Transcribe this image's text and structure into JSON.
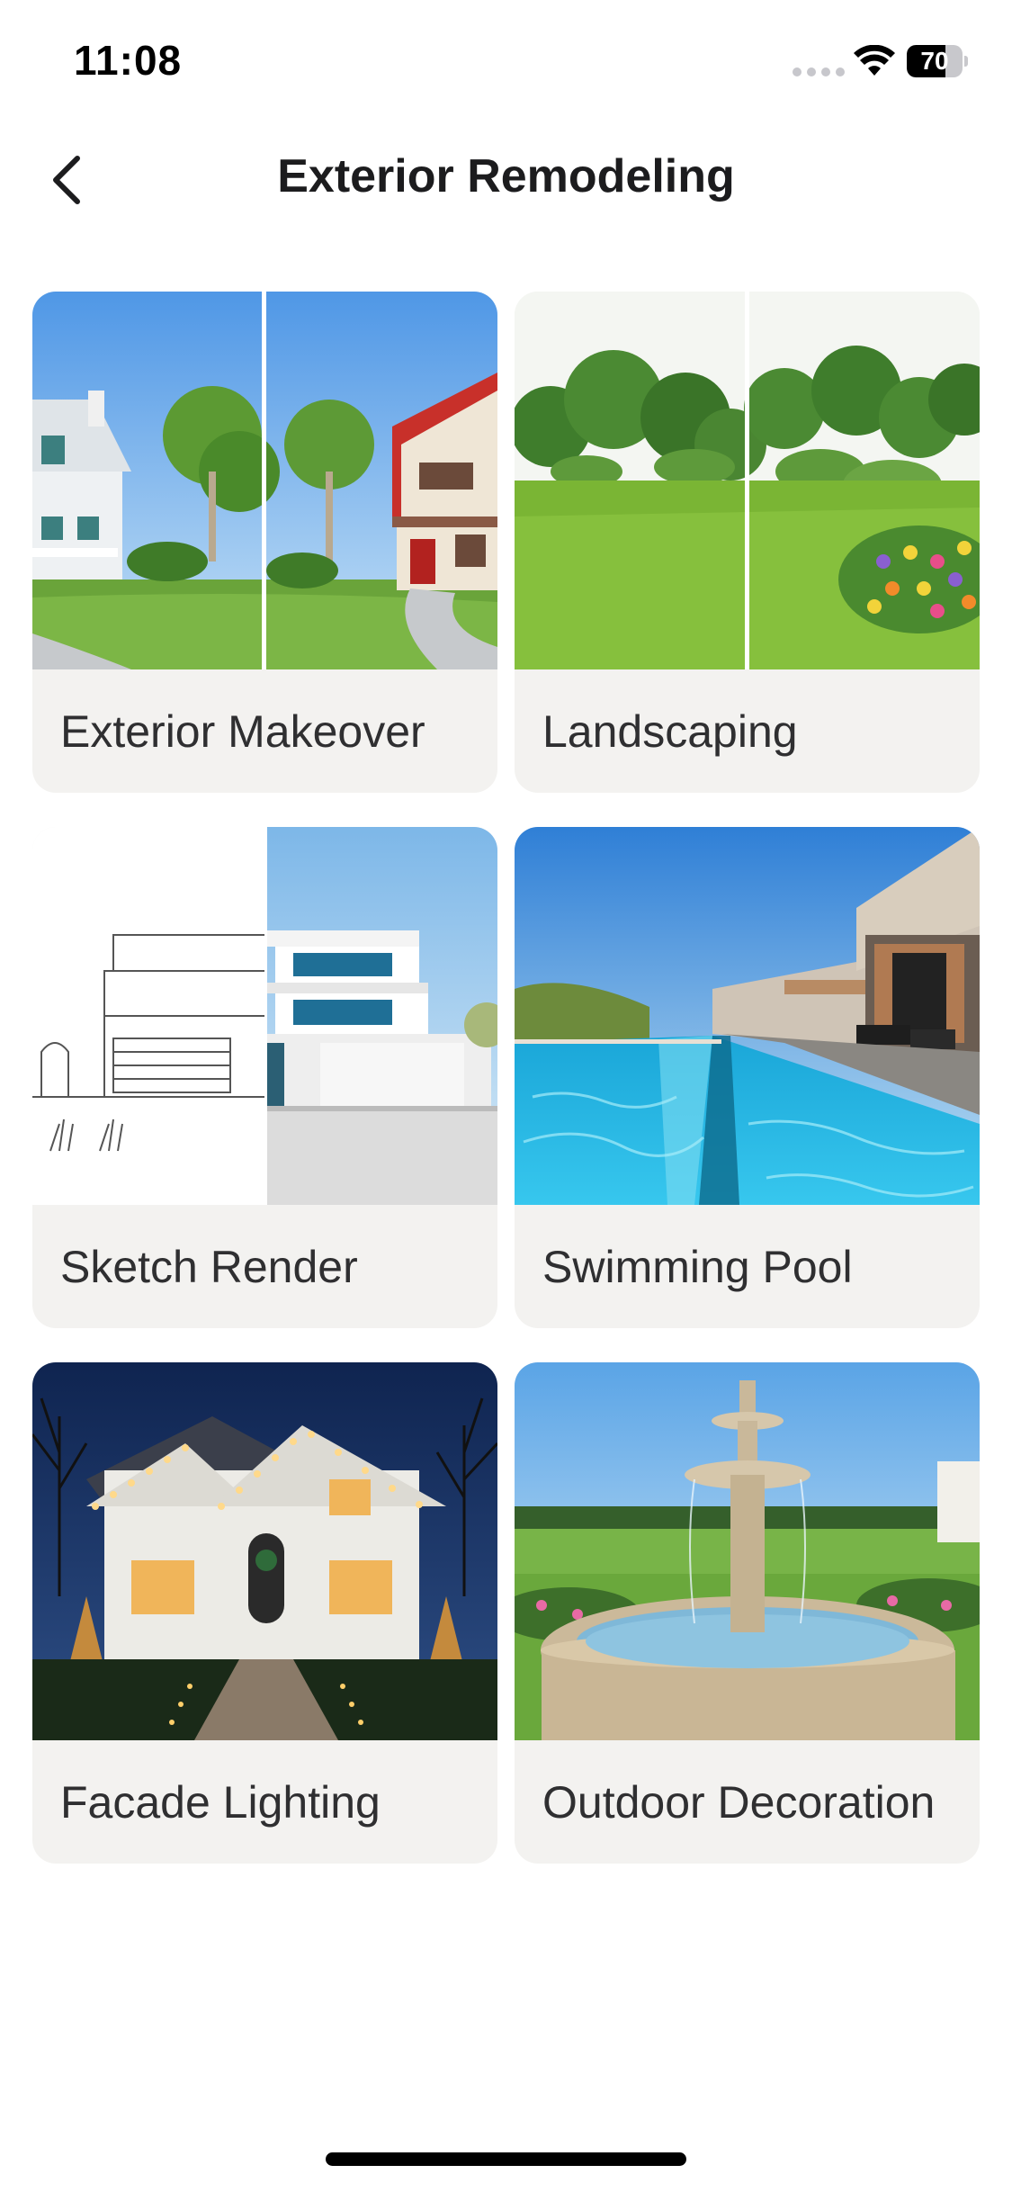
{
  "status_bar": {
    "time": "11:08",
    "battery_level": "70",
    "battery_fraction": 0.7
  },
  "header": {
    "title": "Exterior Remodeling",
    "back_icon": "chevron-left-icon"
  },
  "categories": [
    {
      "label": "Exterior Makeover"
    },
    {
      "label": "Landscaping"
    },
    {
      "label": "Sketch Render"
    },
    {
      "label": "Swimming Pool"
    },
    {
      "label": "Facade Lighting"
    },
    {
      "label": "Outdoor Decoration"
    }
  ],
  "colors": {
    "card_background": "#f3f2f0",
    "title_text": "#1c1c1e",
    "label_text": "#2f2f31"
  }
}
